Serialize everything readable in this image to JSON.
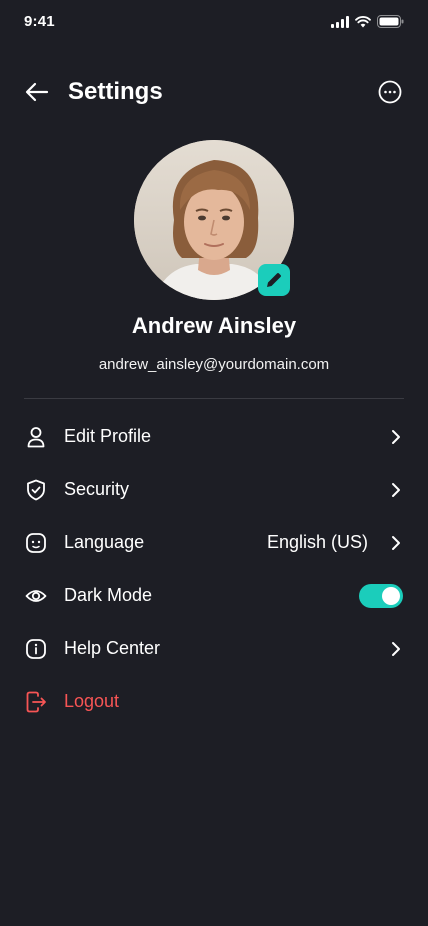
{
  "status_bar": {
    "time": "9:41"
  },
  "header": {
    "title": "Settings"
  },
  "profile": {
    "name": "Andrew Ainsley",
    "email": "andrew_ainsley@yourdomain.com"
  },
  "menu": {
    "items": [
      {
        "label": "Edit Profile",
        "icon": "user-icon"
      },
      {
        "label": "Security",
        "icon": "shield-icon"
      },
      {
        "label": "Language",
        "icon": "language-icon",
        "value": "English (US)"
      },
      {
        "label": "Dark Mode",
        "icon": "eye-icon",
        "toggle": true
      },
      {
        "label": "Help Center",
        "icon": "info-icon"
      },
      {
        "label": "Logout",
        "icon": "logout-icon"
      }
    ]
  },
  "colors": {
    "background": "#1d1e25",
    "accent": "#1bcdbb",
    "danger": "#f75555",
    "text": "#ffffff"
  }
}
